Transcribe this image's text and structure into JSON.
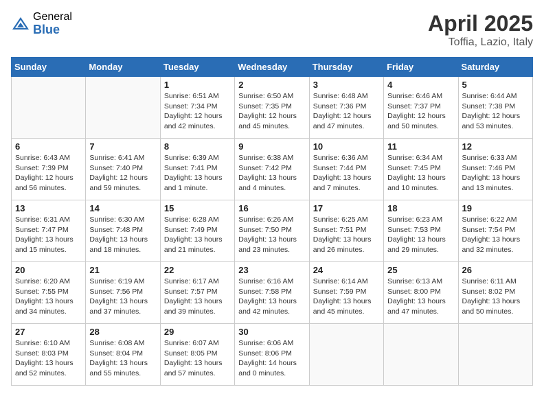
{
  "header": {
    "logo_general": "General",
    "logo_blue": "Blue",
    "month_title": "April 2025",
    "location": "Toffia, Lazio, Italy"
  },
  "days_of_week": [
    "Sunday",
    "Monday",
    "Tuesday",
    "Wednesday",
    "Thursday",
    "Friday",
    "Saturday"
  ],
  "weeks": [
    [
      {
        "day": "",
        "info": ""
      },
      {
        "day": "",
        "info": ""
      },
      {
        "day": "1",
        "info": "Sunrise: 6:51 AM\nSunset: 7:34 PM\nDaylight: 12 hours and 42 minutes."
      },
      {
        "day": "2",
        "info": "Sunrise: 6:50 AM\nSunset: 7:35 PM\nDaylight: 12 hours and 45 minutes."
      },
      {
        "day": "3",
        "info": "Sunrise: 6:48 AM\nSunset: 7:36 PM\nDaylight: 12 hours and 47 minutes."
      },
      {
        "day": "4",
        "info": "Sunrise: 6:46 AM\nSunset: 7:37 PM\nDaylight: 12 hours and 50 minutes."
      },
      {
        "day": "5",
        "info": "Sunrise: 6:44 AM\nSunset: 7:38 PM\nDaylight: 12 hours and 53 minutes."
      }
    ],
    [
      {
        "day": "6",
        "info": "Sunrise: 6:43 AM\nSunset: 7:39 PM\nDaylight: 12 hours and 56 minutes."
      },
      {
        "day": "7",
        "info": "Sunrise: 6:41 AM\nSunset: 7:40 PM\nDaylight: 12 hours and 59 minutes."
      },
      {
        "day": "8",
        "info": "Sunrise: 6:39 AM\nSunset: 7:41 PM\nDaylight: 13 hours and 1 minute."
      },
      {
        "day": "9",
        "info": "Sunrise: 6:38 AM\nSunset: 7:42 PM\nDaylight: 13 hours and 4 minutes."
      },
      {
        "day": "10",
        "info": "Sunrise: 6:36 AM\nSunset: 7:44 PM\nDaylight: 13 hours and 7 minutes."
      },
      {
        "day": "11",
        "info": "Sunrise: 6:34 AM\nSunset: 7:45 PM\nDaylight: 13 hours and 10 minutes."
      },
      {
        "day": "12",
        "info": "Sunrise: 6:33 AM\nSunset: 7:46 PM\nDaylight: 13 hours and 13 minutes."
      }
    ],
    [
      {
        "day": "13",
        "info": "Sunrise: 6:31 AM\nSunset: 7:47 PM\nDaylight: 13 hours and 15 minutes."
      },
      {
        "day": "14",
        "info": "Sunrise: 6:30 AM\nSunset: 7:48 PM\nDaylight: 13 hours and 18 minutes."
      },
      {
        "day": "15",
        "info": "Sunrise: 6:28 AM\nSunset: 7:49 PM\nDaylight: 13 hours and 21 minutes."
      },
      {
        "day": "16",
        "info": "Sunrise: 6:26 AM\nSunset: 7:50 PM\nDaylight: 13 hours and 23 minutes."
      },
      {
        "day": "17",
        "info": "Sunrise: 6:25 AM\nSunset: 7:51 PM\nDaylight: 13 hours and 26 minutes."
      },
      {
        "day": "18",
        "info": "Sunrise: 6:23 AM\nSunset: 7:53 PM\nDaylight: 13 hours and 29 minutes."
      },
      {
        "day": "19",
        "info": "Sunrise: 6:22 AM\nSunset: 7:54 PM\nDaylight: 13 hours and 32 minutes."
      }
    ],
    [
      {
        "day": "20",
        "info": "Sunrise: 6:20 AM\nSunset: 7:55 PM\nDaylight: 13 hours and 34 minutes."
      },
      {
        "day": "21",
        "info": "Sunrise: 6:19 AM\nSunset: 7:56 PM\nDaylight: 13 hours and 37 minutes."
      },
      {
        "day": "22",
        "info": "Sunrise: 6:17 AM\nSunset: 7:57 PM\nDaylight: 13 hours and 39 minutes."
      },
      {
        "day": "23",
        "info": "Sunrise: 6:16 AM\nSunset: 7:58 PM\nDaylight: 13 hours and 42 minutes."
      },
      {
        "day": "24",
        "info": "Sunrise: 6:14 AM\nSunset: 7:59 PM\nDaylight: 13 hours and 45 minutes."
      },
      {
        "day": "25",
        "info": "Sunrise: 6:13 AM\nSunset: 8:00 PM\nDaylight: 13 hours and 47 minutes."
      },
      {
        "day": "26",
        "info": "Sunrise: 6:11 AM\nSunset: 8:02 PM\nDaylight: 13 hours and 50 minutes."
      }
    ],
    [
      {
        "day": "27",
        "info": "Sunrise: 6:10 AM\nSunset: 8:03 PM\nDaylight: 13 hours and 52 minutes."
      },
      {
        "day": "28",
        "info": "Sunrise: 6:08 AM\nSunset: 8:04 PM\nDaylight: 13 hours and 55 minutes."
      },
      {
        "day": "29",
        "info": "Sunrise: 6:07 AM\nSunset: 8:05 PM\nDaylight: 13 hours and 57 minutes."
      },
      {
        "day": "30",
        "info": "Sunrise: 6:06 AM\nSunset: 8:06 PM\nDaylight: 14 hours and 0 minutes."
      },
      {
        "day": "",
        "info": ""
      },
      {
        "day": "",
        "info": ""
      },
      {
        "day": "",
        "info": ""
      }
    ]
  ]
}
